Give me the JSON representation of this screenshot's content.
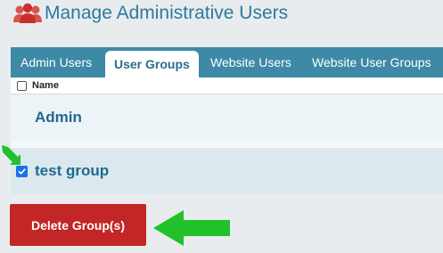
{
  "page": {
    "title": "Manage Administrative Users"
  },
  "tabs": [
    {
      "label": "Admin Users",
      "active": false
    },
    {
      "label": "User Groups",
      "active": true
    },
    {
      "label": "Website Users",
      "active": false
    },
    {
      "label": "Website User Groups",
      "active": false
    }
  ],
  "table": {
    "header": {
      "name": "Name"
    },
    "rows": [
      {
        "name": "Admin",
        "checked": false,
        "has_checkbox": false
      },
      {
        "name": "test group",
        "checked": true,
        "has_checkbox": true
      }
    ]
  },
  "actions": {
    "delete_label": "Delete Group(s)"
  },
  "icons": {
    "title_icon": "users-icon",
    "annotation": "green-arrow-icon"
  },
  "colors": {
    "accent": "#3d89a6",
    "title": "#2b7aa0",
    "danger": "#c22626",
    "annotation": "#22c02a",
    "checkbox": "#1a73e8"
  }
}
